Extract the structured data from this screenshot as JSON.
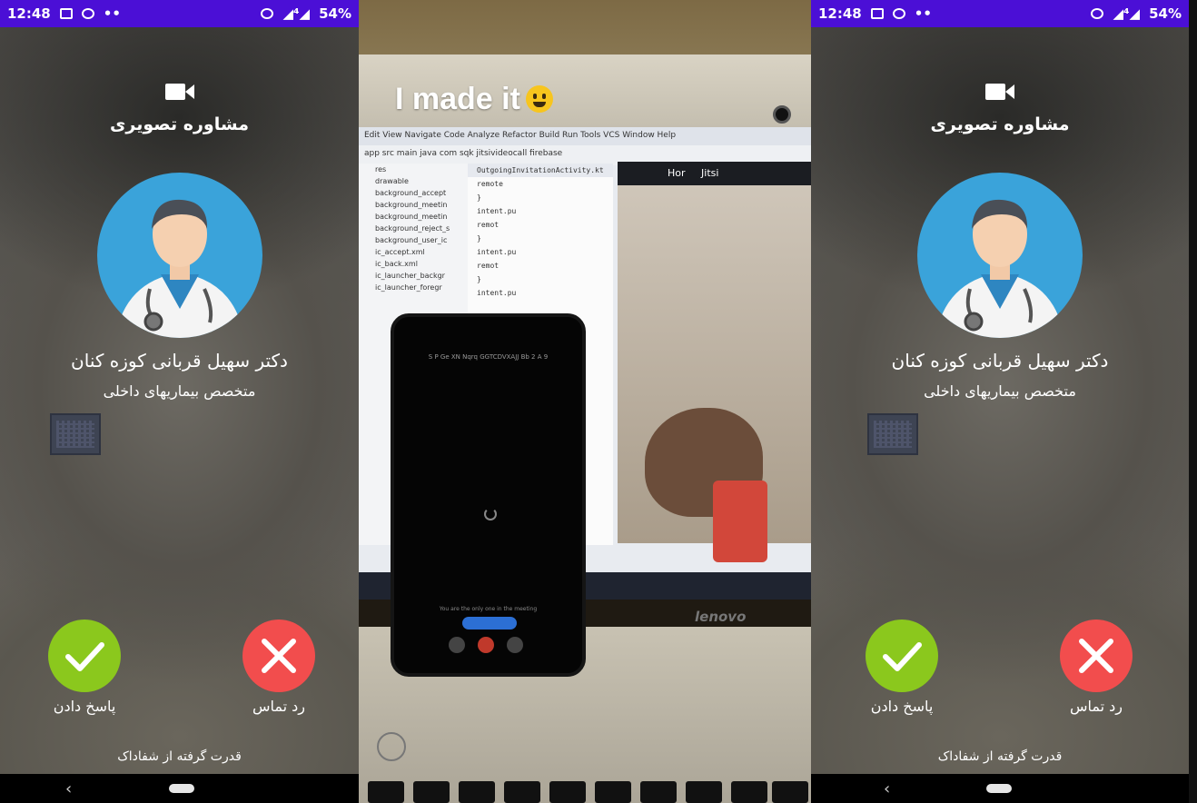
{
  "status_bar": {
    "time": "12:48",
    "dots": "••",
    "signal": "◢⁴◢",
    "battery": "54%"
  },
  "call_screen": {
    "title": "مشاوره تصویری",
    "doctor_name": "دکتر سهیل قربانی کوزه کنان",
    "doctor_specialty": "متخصص بیماریهای داخلی",
    "accept_label": "پاسخ دادن",
    "reject_label": "رد تماس",
    "powered_by": "قدرت گرفته از شفاداک",
    "accept_color": "#8bc81d",
    "reject_color": "#f24d4d",
    "avatar_bg_color": "#3aa3da",
    "status_bar_color": "#4b0fd6"
  },
  "photo": {
    "caption": "I made it",
    "ide_menu": "Edit  View  Navigate  Code  Analyze  Refactor  Build  Run  Tools  VCS  Window  Help",
    "ide_breadcrumb": "app  src  main  java  com  sqk  jitsivideocall  firebase",
    "ide_tab": "OutgoingInvitationActivity.kt",
    "tree_items": [
      "res",
      "drawable",
      "background_accept",
      "background_meetin",
      "background_meetin",
      "background_reject_s",
      "background_user_ic",
      "ic_accept.xml",
      "ic_back.xml",
      "ic_launcher_backgr",
      "ic_launcher_foregr"
    ],
    "code_lines": [
      "remote",
      "}",
      "intent.pu",
      "remot",
      "}",
      "intent.pu",
      "remot",
      "}",
      "intent.pu"
    ],
    "emulator_title": "Jitsi",
    "emulator_tab": "Hor",
    "held_phone_room": "S P Ge XN Nqrq GGTCDVXAJJ Bb 2 A 9",
    "held_phone_message": "You are the only one in the meeting",
    "laptop_brand": "lenovo"
  }
}
